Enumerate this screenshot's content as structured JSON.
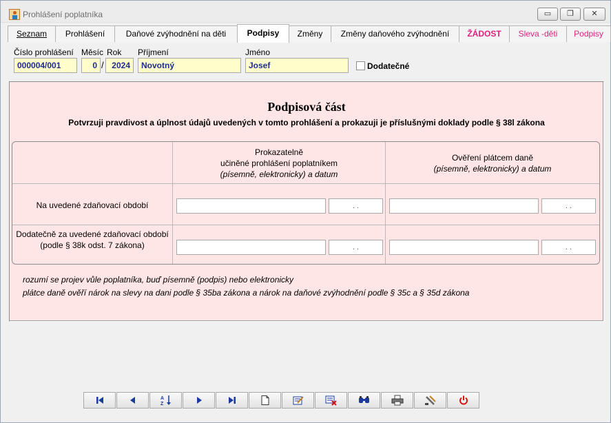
{
  "window": {
    "title": "Prohlášení poplatníka",
    "controls": {
      "minimize": "▭",
      "maximize": "❐",
      "close": "✕"
    }
  },
  "tabs": [
    {
      "label": "Seznam"
    },
    {
      "label": "Prohlášení"
    },
    {
      "label": "Daňové zvýhodnění na děti"
    },
    {
      "label": "Podpisy"
    },
    {
      "label": "Změny"
    },
    {
      "label": "Změny daňového zvýhodnění"
    },
    {
      "label": "ŽÁDOST"
    },
    {
      "label": "Sleva -děti"
    },
    {
      "label": "Podpisy"
    }
  ],
  "header": {
    "cislo_label": "Číslo prohlášení",
    "cislo_value": "000004/001",
    "mesic_label": "Měsíc",
    "mesic_value": "0",
    "rok_label": "Rok",
    "rok_value": "2024",
    "slash": "/",
    "prijmeni_label": "Příjmení",
    "prijmeni_value": "Novotný",
    "jmeno_label": "Jméno",
    "jmeno_value": "Josef",
    "dodatecne_label": "Dodatečné"
  },
  "panel": {
    "title": "Podpisová část",
    "subtitle": "Potvrzuji pravdivost a úplnost údajů uvedených v tomto prohlášení a prokazuji je příslušnými doklady podle § 38l zákona",
    "col1_line1": "Prokazatelně",
    "col1_line2": "učiněné prohlášení poplatníkem",
    "col1_line3": "(písemně, elektronicky) a datum",
    "col2_line1": "Ověření plátcem daně",
    "col2_line2": "(písemně, elektronicky) a datum",
    "row1_label": "Na uvedené zdaňovací období",
    "row2_line1": "Dodatečně za uvedené zdaňovací období",
    "row2_line2": "(podle  § 38k odst. 7 zákona)",
    "date_placeholder": ". .",
    "note1": "rozumí se projev vůle poplatníka, buď písemně (podpis) nebo elektronicky",
    "note2": "plátce daně ověří nárok na slevy na dani podle § 35ba zákona a nárok na daňové zvýhodnění podle §  35c a § 35d zákona"
  },
  "toolbar": {
    "buttons": [
      "first-record-icon",
      "previous-record-icon",
      "sort-az-icon",
      "next-record-icon",
      "last-record-icon",
      "new-record-icon",
      "edit-record-icon",
      "delete-record-icon",
      "search-icon",
      "print-icon",
      "tools-icon",
      "power-icon"
    ],
    "colors": {
      "accent": "#1a3a9c",
      "danger": "#d91010"
    }
  }
}
